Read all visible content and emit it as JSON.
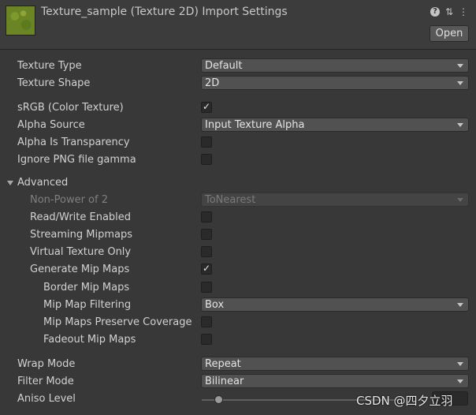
{
  "header": {
    "title": "Texture_sample (Texture 2D) Import Settings",
    "open_label": "Open",
    "icons": [
      "help-icon",
      "presets-icon",
      "more-options-icon"
    ]
  },
  "fields": {
    "texture_type": {
      "label": "Texture Type",
      "value": "Default"
    },
    "texture_shape": {
      "label": "Texture Shape",
      "value": "2D"
    },
    "srgb": {
      "label": "sRGB (Color Texture)",
      "checked": true
    },
    "alpha_source": {
      "label": "Alpha Source",
      "value": "Input Texture Alpha"
    },
    "alpha_is_transparency": {
      "label": "Alpha Is Transparency",
      "checked": false
    },
    "ignore_png_gamma": {
      "label": "Ignore PNG file gamma",
      "checked": false
    },
    "advanced": {
      "label": "Advanced",
      "expanded": true
    },
    "non_power_of_2": {
      "label": "Non-Power of 2",
      "value": "ToNearest",
      "disabled": true
    },
    "read_write": {
      "label": "Read/Write Enabled",
      "checked": false
    },
    "streaming_mipmaps": {
      "label": "Streaming Mipmaps",
      "checked": false
    },
    "virtual_texture_only": {
      "label": "Virtual Texture Only",
      "checked": false
    },
    "generate_mip_maps": {
      "label": "Generate Mip Maps",
      "checked": true
    },
    "border_mip_maps": {
      "label": "Border Mip Maps",
      "checked": false
    },
    "mip_map_filtering": {
      "label": "Mip Map Filtering",
      "value": "Box"
    },
    "mip_maps_preserve_coverage": {
      "label": "Mip Maps Preserve Coverage",
      "checked": false
    },
    "fadeout_mip_maps": {
      "label": "Fadeout Mip Maps",
      "checked": false
    },
    "wrap_mode": {
      "label": "Wrap Mode",
      "value": "Repeat"
    },
    "filter_mode": {
      "label": "Filter Mode",
      "value": "Bilinear"
    },
    "aniso_level": {
      "label": "Aniso Level",
      "slider_fraction": 0.06
    }
  },
  "watermark": "CSDN @四夕立羽"
}
